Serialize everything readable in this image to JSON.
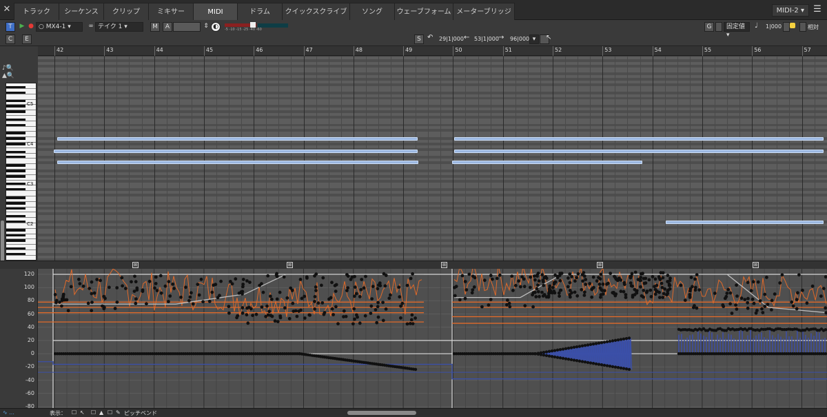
{
  "tabs": [
    {
      "label": "トラック"
    },
    {
      "label": "シーケンス"
    },
    {
      "label": "クリップ"
    },
    {
      "label": "ミキサー"
    },
    {
      "label": "MIDI"
    },
    {
      "label": "ドラム"
    },
    {
      "label": "クイックスクライブ"
    },
    {
      "label": "ソング"
    },
    {
      "label": "ウェーブフォーム"
    },
    {
      "label": "メーターブリッジ"
    }
  ],
  "window_menu": "MIDI-2",
  "toolbar": {
    "track_name": "MX4-1",
    "take_name": "テイク 1",
    "m_label": "M",
    "a_label": "A",
    "c_label": "C",
    "e_label": "E",
    "s_label": "S",
    "pos_start": "29|1|000",
    "pos_mid": "53|1|000",
    "pos_end": "96|000",
    "g_label": "G",
    "fixed_value": "固定値",
    "note_length": "1|000",
    "relative": "相対",
    "meter_scale": "-5  -10  -15  -25  -40  -60"
  },
  "ruler": {
    "bars": [
      "42",
      "43",
      "44",
      "45",
      "46",
      "47",
      "48",
      "49",
      "50",
      "51",
      "52",
      "53",
      "54",
      "55",
      "56",
      "57"
    ]
  },
  "piano": {
    "labels": [
      "C5",
      "C4",
      "C3",
      "C2"
    ]
  },
  "controller": {
    "scale": [
      "120",
      "100",
      "80",
      "60",
      "40",
      "20",
      "0",
      "-20",
      "-40",
      "-60",
      "-80"
    ],
    "blue_color": "#3b4fa8",
    "orange_color": "#e06a2a"
  },
  "bottombar": {
    "display_label": "表示：",
    "lane_type": "ピッチベンド",
    "scroll_position": 0.42
  }
}
